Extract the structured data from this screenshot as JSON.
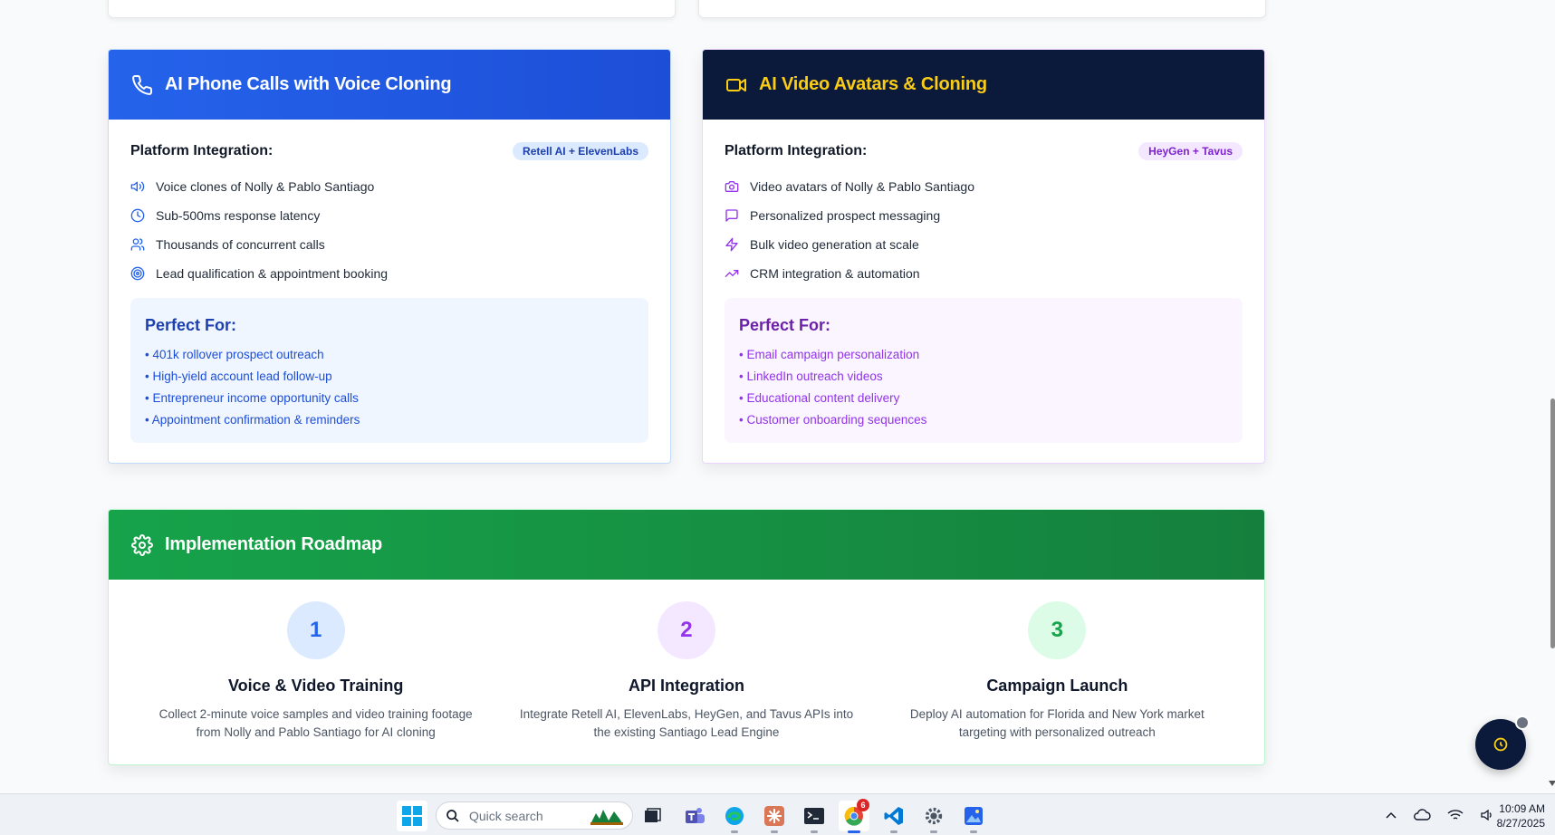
{
  "phone_card": {
    "title": "AI Phone Calls with Voice Cloning",
    "integration_label": "Platform Integration:",
    "badge": "Retell AI + ElevenLabs",
    "features": [
      {
        "icon": "speaker-icon",
        "text": "Voice clones of Nolly & Pablo Santiago"
      },
      {
        "icon": "clock-icon",
        "text": "Sub-500ms response latency"
      },
      {
        "icon": "users-icon",
        "text": "Thousands of concurrent calls"
      },
      {
        "icon": "target-icon",
        "text": "Lead qualification & appointment booking"
      }
    ],
    "perfect_title": "Perfect For:",
    "perfect_items": [
      "• 401k rollover prospect outreach",
      "• High-yield account lead follow-up",
      "• Entrepreneur income opportunity calls",
      "• Appointment confirmation & reminders"
    ]
  },
  "video_card": {
    "title": "AI Video Avatars & Cloning",
    "integration_label": "Platform Integration:",
    "badge": "HeyGen + Tavus",
    "features": [
      {
        "icon": "camera-icon",
        "text": "Video avatars of Nolly & Pablo Santiago"
      },
      {
        "icon": "message-icon",
        "text": "Personalized prospect messaging"
      },
      {
        "icon": "lightning-icon",
        "text": "Bulk video generation at scale"
      },
      {
        "icon": "trending-up-icon",
        "text": "CRM integration & automation"
      }
    ],
    "perfect_title": "Perfect For:",
    "perfect_items": [
      "• Email campaign personalization",
      "• LinkedIn outreach videos",
      "• Educational content delivery",
      "• Customer onboarding sequences"
    ]
  },
  "roadmap": {
    "title": "Implementation Roadmap",
    "steps": [
      {
        "number": "1",
        "title": "Voice & Video Training",
        "desc": "Collect 2-minute voice samples and video training footage from Nolly and Pablo Santiago for AI cloning"
      },
      {
        "number": "2",
        "title": "API Integration",
        "desc": "Integrate Retell AI, ElevenLabs, HeyGen, and Tavus APIs into the existing Santiago Lead Engine"
      },
      {
        "number": "3",
        "title": "Campaign Launch",
        "desc": "Deploy AI automation for Florida and New York market targeting with personalized outreach"
      }
    ]
  },
  "taskbar": {
    "search_placeholder": "Quick search",
    "chrome_badge": "6",
    "time": "10:09 AM",
    "date": "8/27/2025"
  },
  "colors": {
    "phone_header": "#2563eb",
    "video_header": "#0b1a3b",
    "video_title": "#facc15",
    "roadmap_header": "#16a34a"
  }
}
